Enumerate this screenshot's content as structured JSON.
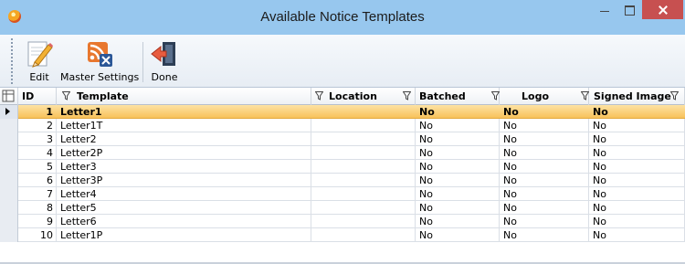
{
  "window": {
    "title": "Available Notice Templates",
    "icon": "app-icon"
  },
  "toolbar": {
    "edit_label": "Edit",
    "master_settings_label": "Master Settings",
    "done_label": "Done"
  },
  "grid": {
    "columns": [
      "ID",
      "Template",
      "Location",
      "Batched",
      "Logo",
      "Signed Image"
    ],
    "selected_row": 0,
    "rows": [
      {
        "id": "1",
        "template": "Letter1",
        "location": "",
        "batched": "No",
        "logo": "No",
        "signed_image": "No"
      },
      {
        "id": "2",
        "template": "Letter1T",
        "location": "",
        "batched": "No",
        "logo": "No",
        "signed_image": "No"
      },
      {
        "id": "3",
        "template": "Letter2",
        "location": "",
        "batched": "No",
        "logo": "No",
        "signed_image": "No"
      },
      {
        "id": "4",
        "template": "Letter2P",
        "location": "",
        "batched": "No",
        "logo": "No",
        "signed_image": "No"
      },
      {
        "id": "5",
        "template": "Letter3",
        "location": "",
        "batched": "No",
        "logo": "No",
        "signed_image": "No"
      },
      {
        "id": "6",
        "template": "Letter3P",
        "location": "",
        "batched": "No",
        "logo": "No",
        "signed_image": "No"
      },
      {
        "id": "7",
        "template": "Letter4",
        "location": "",
        "batched": "No",
        "logo": "No",
        "signed_image": "No"
      },
      {
        "id": "8",
        "template": "Letter5",
        "location": "",
        "batched": "No",
        "logo": "No",
        "signed_image": "No"
      },
      {
        "id": "9",
        "template": "Letter6",
        "location": "",
        "batched": "No",
        "logo": "No",
        "signed_image": "No"
      },
      {
        "id": "10",
        "template": "Letter1P",
        "location": "",
        "batched": "No",
        "logo": "No",
        "signed_image": "No"
      }
    ]
  }
}
